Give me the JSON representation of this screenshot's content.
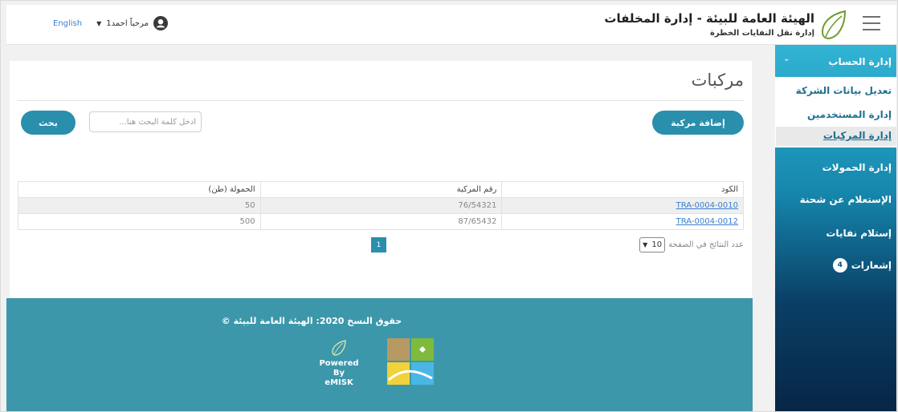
{
  "header": {
    "brand_title": "الهيئة العامة للبيئة - إدارة المخلفات",
    "brand_subtitle": "إدارة نقل النفايات الخطرة",
    "user_greeting": "مرحباً احمد1",
    "language_link": "English",
    "icons": [
      "hamburger-icon",
      "leaf-logo",
      "user-avatar-icon",
      "chevron-down-icon"
    ]
  },
  "sidebar": {
    "account_label": "إدارة الحساب",
    "submenu": {
      "company": "تعديل بيانات الشركة",
      "users": "إدارة المستخدمين",
      "vehicles": "إدارة المركبات"
    },
    "loads": "إدارة الحمولات",
    "inquiry": "الإستعلام عن شحنة",
    "receive": "إستلام نفايات",
    "notifications": "إشعارات",
    "notification_count": "4"
  },
  "main": {
    "title": "مركبات",
    "add_button": "إضافة مركبة",
    "search_button": "بحث",
    "search_placeholder": "أدخل كلمة البحث هنا...",
    "table": {
      "headers": {
        "code": "الكود",
        "plate": "رقم المركبة",
        "load": "الحمولة (طن)"
      },
      "rows": [
        {
          "code": "TRA-0004-0010",
          "plate": "76/54321",
          "load": "50"
        },
        {
          "code": "TRA-0004-0012",
          "plate": "87/65432",
          "load": "500"
        }
      ]
    },
    "page_size_label": "عدد النتائج في الصفحة",
    "page_size_value": "10",
    "current_page": "1"
  },
  "footer": {
    "copyright": "حقوق النسخ 2020: الهيئة العامة للبيئة ©",
    "powered_by_line1": "Powered By",
    "powered_by_line2": "eMISK"
  },
  "colors": {
    "accent": "#2a8fad",
    "footer_bg": "#3c97ab",
    "link": "#3a7fd0"
  }
}
